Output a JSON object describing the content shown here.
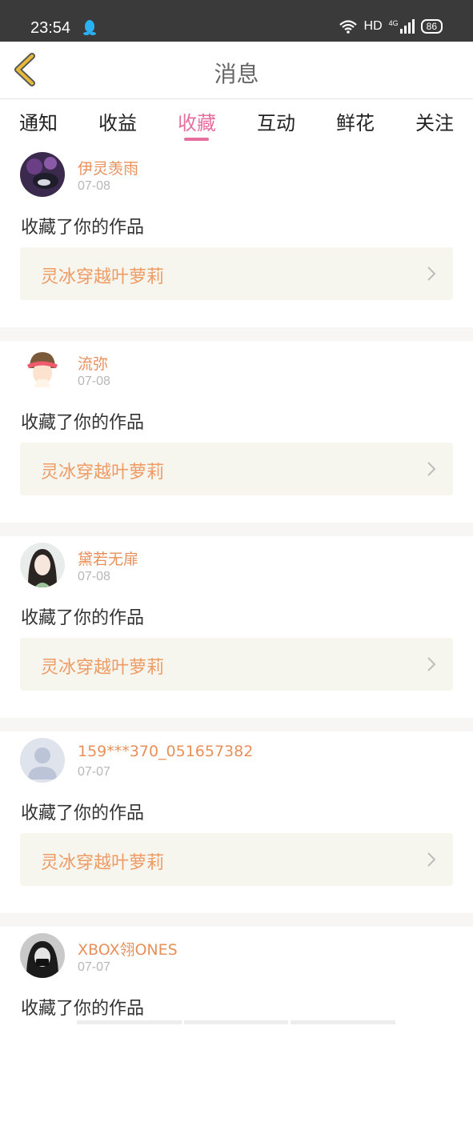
{
  "status_bar": {
    "time": "23:54",
    "network": "HD",
    "signal": "4G",
    "battery": "86"
  },
  "header": {
    "title": "消息"
  },
  "tabs": [
    {
      "label": "通知"
    },
    {
      "label": "收益"
    },
    {
      "label": "收藏"
    },
    {
      "label": "互动"
    },
    {
      "label": "鲜花"
    },
    {
      "label": "关注"
    }
  ],
  "active_tab": "收藏",
  "items": [
    {
      "user": "伊灵羡雨",
      "date": "07-08",
      "action": "收藏了你的作品",
      "work": "灵冰穿越叶萝莉"
    },
    {
      "user": "流弥",
      "date": "07-08",
      "action": "收藏了你的作品",
      "work": "灵冰穿越叶萝莉"
    },
    {
      "user": "黛若无扉",
      "date": "07-08",
      "action": "收藏了你的作品",
      "work": "灵冰穿越叶萝莉"
    },
    {
      "user": "159***370_051657382",
      "date": "07-07",
      "action": "收藏了你的作品",
      "work": "灵冰穿越叶萝莉"
    },
    {
      "user": "XBOX翎ONES",
      "date": "07-07",
      "action": "收藏了你的作品",
      "work": ""
    }
  ],
  "colors": {
    "accent": "#e56f9f",
    "username": "#e8905a",
    "work_title": "#ee9b64",
    "card_bg": "#f6f5ee",
    "back_arrow": "#e6b93a"
  }
}
